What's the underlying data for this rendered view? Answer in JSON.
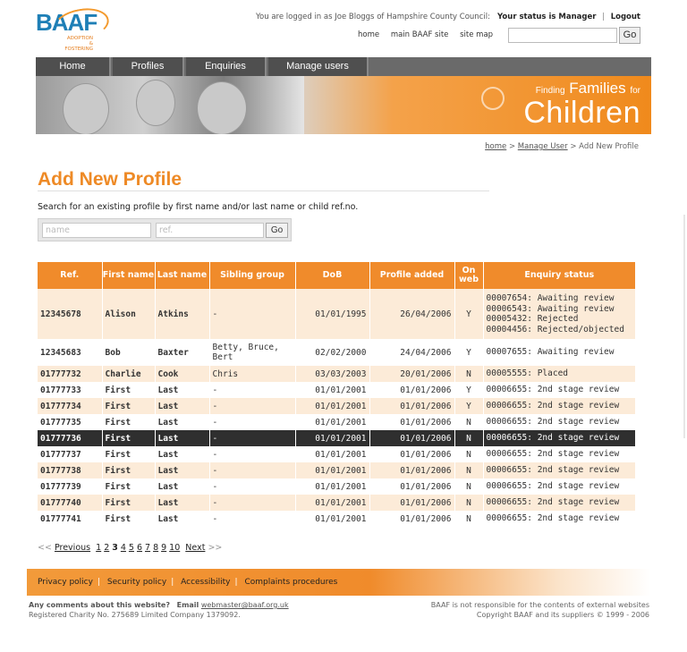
{
  "brand": {
    "logo_text": "BAAF",
    "logo_sub1": "ADOPTION",
    "logo_sub2": "& FOSTERING"
  },
  "header": {
    "login_text": "You are logged in as Joe Bloggs of Hampshire County Council:",
    "status_text": "Your status is Manager",
    "logout_label": "Logout",
    "links": [
      "home",
      "main BAAF site",
      "site map"
    ],
    "search_value": "",
    "go_label": "Go"
  },
  "nav": {
    "tabs": [
      "Home",
      "Profiles",
      "Enquiries",
      "Manage users"
    ]
  },
  "banner": {
    "line1_small": "Finding",
    "line1_big": "Families",
    "line1_end": "for",
    "line2": "Children"
  },
  "breadcrumb": {
    "home": "home",
    "sep1": " > ",
    "manage_user": "Manage User",
    "sep2": " > ",
    "current": "Add New Profile"
  },
  "main": {
    "title": "Add New Profile",
    "instructions": "Search for an existing profile by first name and/or last name or child ref.no.",
    "name_placeholder": "name",
    "ref_placeholder": "ref.",
    "go_label": "Go"
  },
  "table": {
    "headers": [
      "Ref.",
      "First name",
      "Last name",
      "Sibling group",
      "DoB",
      "Profile added",
      "On web",
      "Enquiry status"
    ],
    "rows": [
      {
        "ref": "12345678",
        "first": "Alison",
        "last": "Atkins",
        "sibling": "-",
        "dob": "01/01/1995",
        "added": "26/04/2006",
        "web": "Y",
        "status": [
          "00007654: Awaiting review",
          "00006543: Awaiting review",
          "00005432: Rejected",
          "00004456: Rejected/objected"
        ]
      },
      {
        "ref": "12345683",
        "first": "Bob",
        "last": "Baxter",
        "sibling": "Betty, Bruce, Bert",
        "dob": "02/02/2000",
        "added": "24/04/2006",
        "web": "Y",
        "status": [
          "00007655: Awaiting review"
        ]
      },
      {
        "ref": "01777732",
        "first": "Charlie",
        "last": "Cook",
        "sibling": "Chris",
        "dob": "03/03/2003",
        "added": "20/01/2006",
        "web": "N",
        "status": [
          "00005555: Placed"
        ]
      },
      {
        "ref": "01777733",
        "first": "First",
        "last": "Last",
        "sibling": "-",
        "dob": "01/01/2001",
        "added": "01/01/2006",
        "web": "Y",
        "status": [
          "00006655: 2nd stage review"
        ]
      },
      {
        "ref": "01777734",
        "first": "First",
        "last": "Last",
        "sibling": "-",
        "dob": "01/01/2001",
        "added": "01/01/2006",
        "web": "Y",
        "status": [
          "00006655: 2nd stage review"
        ]
      },
      {
        "ref": "01777735",
        "first": "First",
        "last": "Last",
        "sibling": "-",
        "dob": "01/01/2001",
        "added": "01/01/2006",
        "web": "N",
        "status": [
          "00006655: 2nd stage review"
        ]
      },
      {
        "ref": "01777736",
        "first": "First",
        "last": "Last",
        "sibling": "-",
        "dob": "01/01/2001",
        "added": "01/01/2006",
        "web": "N",
        "status": [
          "00006655: 2nd stage review"
        ],
        "selected": true
      },
      {
        "ref": "01777737",
        "first": "First",
        "last": "Last",
        "sibling": "-",
        "dob": "01/01/2001",
        "added": "01/01/2006",
        "web": "N",
        "status": [
          "00006655: 2nd stage review"
        ]
      },
      {
        "ref": "01777738",
        "first": "First",
        "last": "Last",
        "sibling": "-",
        "dob": "01/01/2001",
        "added": "01/01/2006",
        "web": "N",
        "status": [
          "00006655: 2nd stage review"
        ]
      },
      {
        "ref": "01777739",
        "first": "First",
        "last": "Last",
        "sibling": "-",
        "dob": "01/01/2001",
        "added": "01/01/2006",
        "web": "N",
        "status": [
          "00006655: 2nd stage review"
        ]
      },
      {
        "ref": "01777740",
        "first": "First",
        "last": "Last",
        "sibling": "-",
        "dob": "01/01/2001",
        "added": "01/01/2006",
        "web": "N",
        "status": [
          "00006655: 2nd stage review"
        ]
      },
      {
        "ref": "01777741",
        "first": "First",
        "last": "Last",
        "sibling": "-",
        "dob": "01/01/2001",
        "added": "01/01/2006",
        "web": "N",
        "status": [
          "00006655: 2nd stage review"
        ]
      }
    ]
  },
  "pager": {
    "prev_arrows": "<<",
    "prev_label": "Previous",
    "pages": [
      "1",
      "2",
      "3",
      "4",
      "5",
      "6",
      "7",
      "8",
      "9",
      "10"
    ],
    "current": "3",
    "next_label": "Next",
    "next_arrows": ">>"
  },
  "footer": {
    "links": [
      "Privacy policy",
      "Security policy",
      "Accessibility",
      "Complaints procedures"
    ],
    "comments_label": "Any comments about this website?",
    "email_label": "Email",
    "email": "webmaster@baaf.org.uk",
    "registered": "Registered Charity No. 275689    Limited Company 1379092.",
    "disclaimer": "BAAF is not responsible for the contents of external websites",
    "copyright": "Copyright BAAF and its suppliers © 1999 - 2006"
  },
  "colors": {
    "accent": "#f08b2b",
    "brand_blue": "#1e7fb6",
    "nav_bg": "#4f4f4f",
    "selected_row": "#2f2f2f"
  }
}
